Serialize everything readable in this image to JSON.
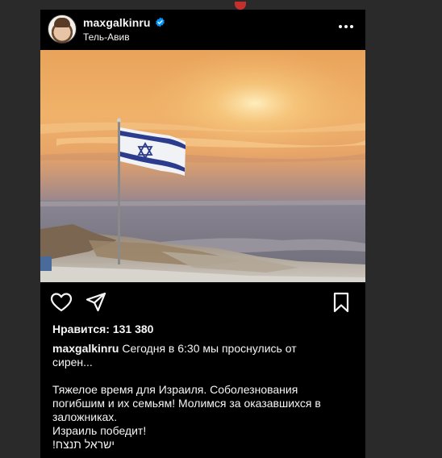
{
  "post": {
    "username": "maxgalkinru",
    "verified": true,
    "location": "Тель-Авив",
    "likes_label": "Нравится: 131 380",
    "caption": {
      "username": "maxgalkinru",
      "text_line1": " Сегодня в 6:30 мы проснулись от",
      "text_line2": "сирен...",
      "para_line1": "Тяжелое время для Израиля. Соболезнования",
      "para_line2": "погибшим и их семьям! Молимся за оказавшихся в",
      "para_line3": "заложниках.",
      "para_line4": "Израиль победит!",
      "para_line5": "ישראל תנצח!"
    }
  },
  "icons": {
    "more": "more-options-icon",
    "like": "heart-icon",
    "share": "send-icon",
    "save": "bookmark-icon",
    "verified": "verified-badge-icon"
  },
  "colors": {
    "background": "#2a2a2a",
    "post_background": "#000000",
    "text": "#f5f5f5",
    "verified": "#0095f6",
    "notification": "#c4302b"
  }
}
